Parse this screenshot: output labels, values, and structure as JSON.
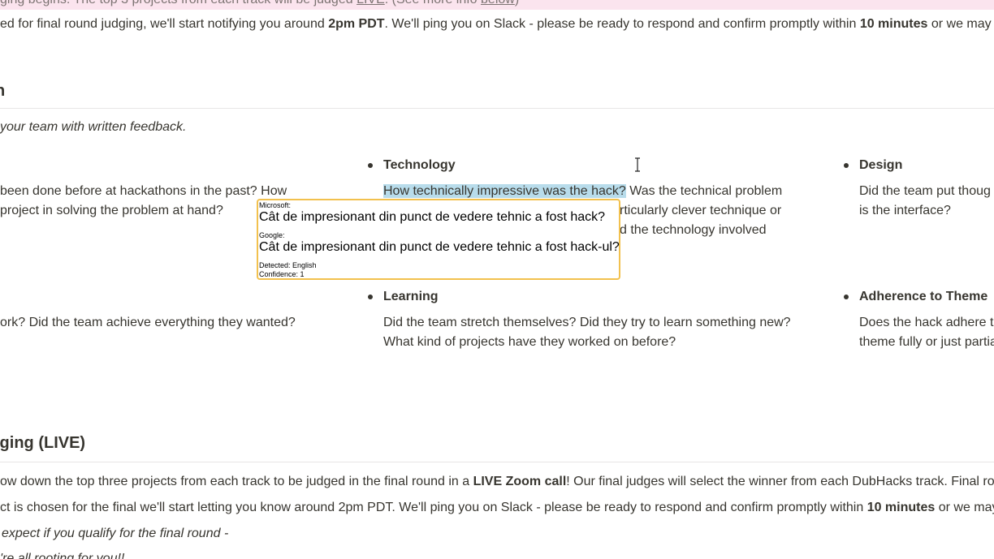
{
  "banner": {
    "pre": "ging begins. The top 3 projects from each track will be judged ",
    "live": "LIVE",
    "post": ". (See more info ",
    "below": "below",
    "close": ")"
  },
  "notice": {
    "pre": "ed for final round judging, we'll start notifying you around ",
    "time": "2pm PDT",
    "mid": ". We'll ping you on Slack - please be ready to respond and confirm promptly within ",
    "minutes": "10 minutes",
    "post": " or we may"
  },
  "section": {
    "heading_fragment": "n",
    "intro": "your team with written feedback."
  },
  "criteria": {
    "col1": {
      "line1": "been done before at hackathons in the past? How",
      "line2": "project in solving the problem at hand?",
      "line3": "ork? Did the team achieve everything they wanted?"
    },
    "technology": {
      "title": "Technology",
      "highlighted": "How technically impressive was the hack?",
      "line1_rest": " Was the technical problem",
      "line2": "rticularly clever technique or",
      "line3": "d the technology involved"
    },
    "design": {
      "title": "Design",
      "line1": "Did the team put thoug",
      "line2": "is the interface?"
    },
    "learning": {
      "title": "Learning",
      "line1": "Did the team stretch themselves? Did they try to learn something new?",
      "line2": "What kind of projects have they worked on before?"
    },
    "theme": {
      "title": "Adherence to Theme",
      "line1": "Does the hack adhere to",
      "line2": "theme fully or just partia"
    }
  },
  "translation_popup": {
    "ms_label": "Microsoft:",
    "ms_text": "Cât de impresionant din punct de vedere tehnic a fost hack?",
    "google_label": "Google:",
    "google_text": "Cât de impresionant din punct de vedere tehnic a fost hack-ul?",
    "detected": "Detected: English",
    "confidence": "Confidence: 1"
  },
  "final_round": {
    "heading": "lging (LIVE)",
    "p1_pre": "ow down the top three projects from each track to be judged in the final round in a ",
    "p1_bold": "LIVE Zoom call",
    "p1_post": "! Our final judges will select the winner from each DubHacks track. Final rou",
    "p2_pre": "ct is chosen for the final we'll start letting you know around 2pm PDT. We'll ping you on Slack - please be ready to respond and confirm promptly within ",
    "p2_bold": "10 minutes",
    "p2_post": " or we may",
    "p3": "expect if you qualify for the final round -",
    "p4": "'re all rooting for you!!"
  }
}
